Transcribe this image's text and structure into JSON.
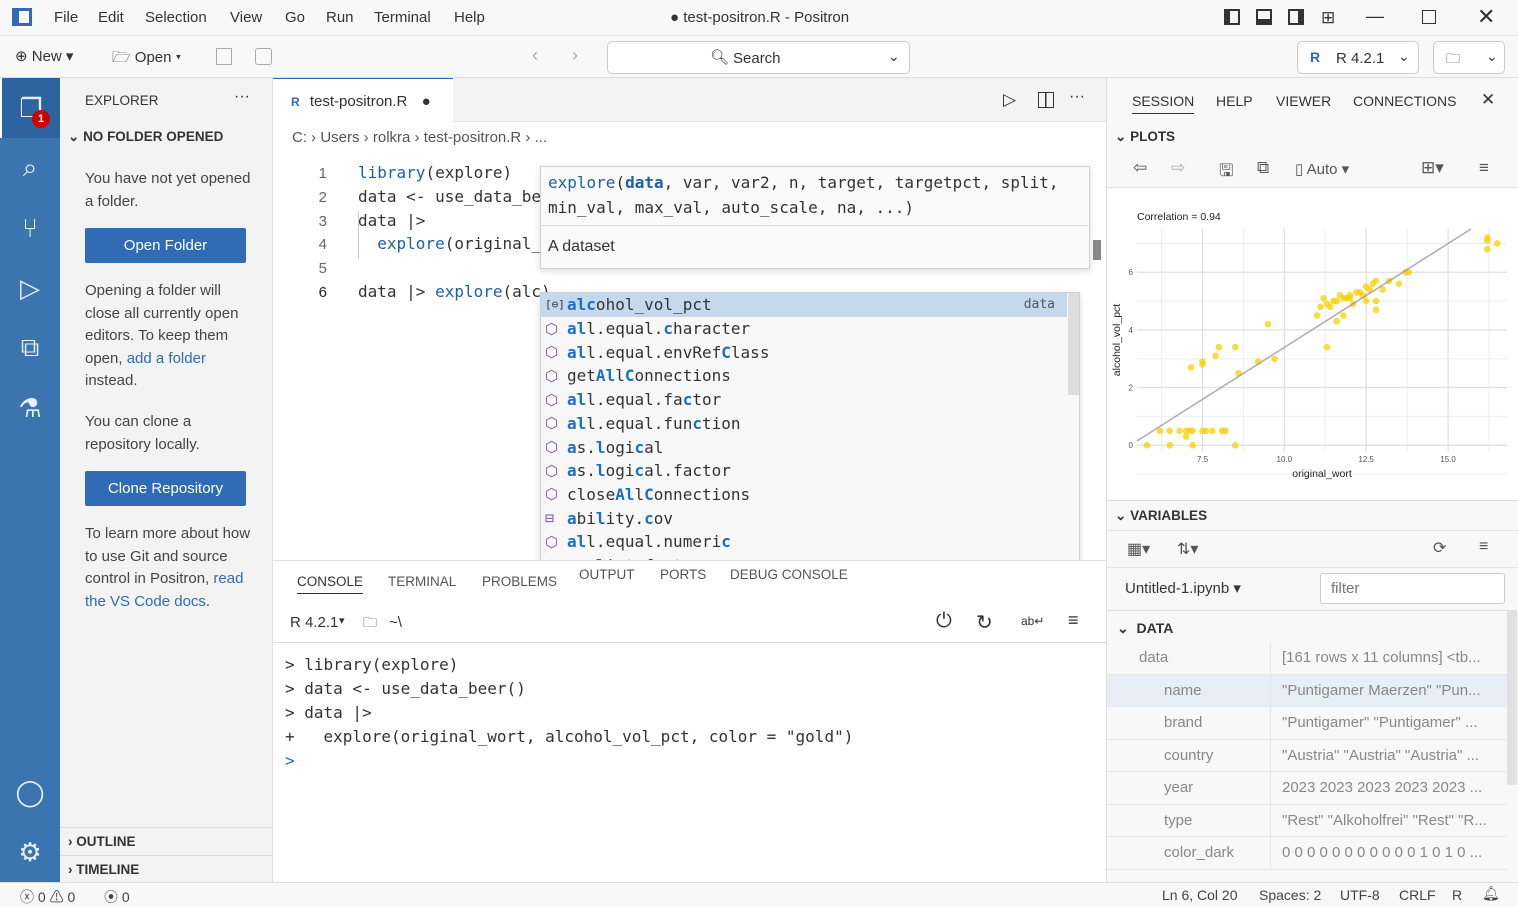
{
  "window": {
    "title": "● test-positron.R - Positron",
    "menu": [
      "File",
      "Edit",
      "Selection",
      "View",
      "Go",
      "Run",
      "Terminal",
      "Help"
    ]
  },
  "toolbar": {
    "new": "New",
    "open": "Open",
    "search": "Search",
    "r_version": "R 4.2.1"
  },
  "explorer": {
    "title": "EXPLORER",
    "section": "NO FOLDER OPENED",
    "msg1": "You have not yet opened a folder.",
    "open_folder": "Open Folder",
    "msg2a": "Opening a folder will close all currently open editors. To keep them open, ",
    "msg2link": "add a folder",
    "msg2b": " instead.",
    "msg3": "You can clone a repository locally.",
    "clone": "Clone Repository",
    "msg4a": "To learn more about how to use Git and source control in Positron, ",
    "msg4link": "read the VS Code docs",
    "msg4b": ".",
    "outline": "OUTLINE",
    "timeline": "TIMELINE",
    "badge": "1"
  },
  "editor": {
    "tab": "test-positron.R",
    "breadcrumb": [
      "C:",
      "Users",
      "rolkra",
      "test-positron.R",
      "..."
    ],
    "lines": [
      {
        "n": "1",
        "text": "library(explore)"
      },
      {
        "n": "2",
        "text": "data <- use_data_be"
      },
      {
        "n": "3",
        "text": "data |>"
      },
      {
        "n": "4",
        "text": "  explore(original_"
      },
      {
        "n": "5",
        "text": ""
      },
      {
        "n": "6",
        "text": "data |> explore(alc)"
      }
    ],
    "signature": {
      "line1": "explore(data, var, var2, n, target, targetpct, split,",
      "line2": "min_val, max_val, auto_scale, na, ...)",
      "doc": "A dataset"
    },
    "suggestions": [
      {
        "label": "alcohol_vol_pct",
        "detail": "data",
        "kind": "variable"
      },
      {
        "label": "all.equal.character",
        "kind": "method"
      },
      {
        "label": "all.equal.envRefClass",
        "kind": "method"
      },
      {
        "label": "getAllConnections",
        "kind": "method"
      },
      {
        "label": "all.equal.factor",
        "kind": "method"
      },
      {
        "label": "all.equal.function",
        "kind": "method"
      },
      {
        "label": "as.logical",
        "kind": "method"
      },
      {
        "label": "as.logical.factor",
        "kind": "method"
      },
      {
        "label": "closeAllConnections",
        "kind": "method"
      },
      {
        "label": "ability.cov",
        "kind": "field"
      },
      {
        "label": "all.equal.numeric",
        "kind": "method"
      },
      {
        "label": "as.list.factor",
        "kind": "method"
      }
    ]
  },
  "panel": {
    "tabs": [
      "CONSOLE",
      "TERMINAL",
      "PROBLEMS",
      "OUTPUT",
      "PORTS",
      "DEBUG CONSOLE"
    ],
    "r_version": "R 4.2.1",
    "path": "~\\",
    "console": [
      "> library(explore)",
      "> data <- use_data_beer()",
      "> data |>",
      "+   explore(original_wort, alcohol_vol_pct, color = \"gold\")",
      ">"
    ]
  },
  "right": {
    "tabs": [
      "SESSION",
      "HELP",
      "VIEWER",
      "CONNECTIONS"
    ],
    "plots_title": "PLOTS",
    "auto": "Auto",
    "variables_title": "VARIABLES",
    "notebook": "Untitled-1.ipynb",
    "filter_placeholder": "filter",
    "data_group": "DATA",
    "variables": [
      {
        "k": "data",
        "v": "[161 rows x 11 columns] <tb..."
      },
      {
        "k": "name",
        "v": "\"Puntigamer Maerzen\" \"Pun..."
      },
      {
        "k": "brand",
        "v": "\"Puntigamer\" \"Puntigamer\" ..."
      },
      {
        "k": "country",
        "v": "\"Austria\" \"Austria\" \"Austria\" ..."
      },
      {
        "k": "year",
        "v": "2023 2023 2023 2023 2023 ..."
      },
      {
        "k": "type",
        "v": "\"Rest\" \"Alkoholfrei\" \"Rest\" \"R..."
      },
      {
        "k": "color_dark",
        "v": "0 0 0 0 0 0 0 0 0 0 0 1 0 1 0 ..."
      }
    ]
  },
  "chart_data": {
    "type": "scatter",
    "title": "Correlation = 0.94",
    "xlabel": "original_wort",
    "ylabel": "alcohol_vol_pct",
    "xlim": [
      5.5,
      16.8
    ],
    "ylim": [
      -0.2,
      7.5
    ],
    "xticks": [
      "7.5",
      "10.0",
      "12.5",
      "15.0"
    ],
    "yticks": [
      "0",
      "2",
      "4",
      "6"
    ],
    "color": "#f5d000",
    "grid": true,
    "points": [
      [
        5.8,
        0
      ],
      [
        6.2,
        0.5
      ],
      [
        6.5,
        0.5
      ],
      [
        6.5,
        0
      ],
      [
        6.8,
        0.5
      ],
      [
        7,
        0.5
      ],
      [
        7,
        0.3
      ],
      [
        7.1,
        0.5
      ],
      [
        7.2,
        0.5
      ],
      [
        7.2,
        0
      ],
      [
        7.5,
        0.5
      ],
      [
        7.6,
        0.5
      ],
      [
        7.8,
        0.5
      ],
      [
        8.1,
        0.5
      ],
      [
        8.2,
        0.5
      ],
      [
        8.5,
        0
      ],
      [
        7.15,
        2.7
      ],
      [
        7.5,
        2.9
      ],
      [
        7.5,
        2.8
      ],
      [
        7.9,
        3.1
      ],
      [
        8,
        3.4
      ],
      [
        8.5,
        3.4
      ],
      [
        8.6,
        2.5
      ],
      [
        9.2,
        2.9
      ],
      [
        9.5,
        4.2
      ],
      [
        9.7,
        3
      ],
      [
        11,
        4.5
      ],
      [
        11.1,
        4.8
      ],
      [
        11.2,
        5.1
      ],
      [
        11.3,
        4.9
      ],
      [
        11.3,
        3.4
      ],
      [
        11.4,
        4.8
      ],
      [
        11.5,
        5
      ],
      [
        11.6,
        4.3
      ],
      [
        11.6,
        5
      ],
      [
        11.7,
        5.2
      ],
      [
        11.8,
        4.5
      ],
      [
        11.8,
        5.1
      ],
      [
        11.9,
        5.1
      ],
      [
        12,
        5.2
      ],
      [
        12,
        5.1
      ],
      [
        12.1,
        4.9
      ],
      [
        12.2,
        5.3
      ],
      [
        12.3,
        5.3
      ],
      [
        12.4,
        5.2
      ],
      [
        12.5,
        5.5
      ],
      [
        12.5,
        5
      ],
      [
        12.6,
        5.4
      ],
      [
        12.7,
        5.6
      ],
      [
        12.8,
        5.7
      ],
      [
        12.8,
        5
      ],
      [
        12.8,
        4.7
      ],
      [
        13,
        5.4
      ],
      [
        13.2,
        5.7
      ],
      [
        13.5,
        5.6
      ],
      [
        13.7,
        6
      ],
      [
        13.8,
        6
      ],
      [
        16.2,
        7.1
      ],
      [
        16.2,
        6.8
      ],
      [
        16.2,
        7.2
      ],
      [
        16.5,
        7
      ]
    ],
    "trend": [
      [
        5.5,
        0.15
      ],
      [
        15.7,
        7.5
      ]
    ]
  },
  "status": {
    "errors": "0",
    "warnings": "0",
    "ports": "0",
    "position": "Ln 6, Col 20",
    "spaces": "Spaces: 2",
    "encoding": "UTF-8",
    "eol": "CRLF",
    "lang": "R"
  }
}
